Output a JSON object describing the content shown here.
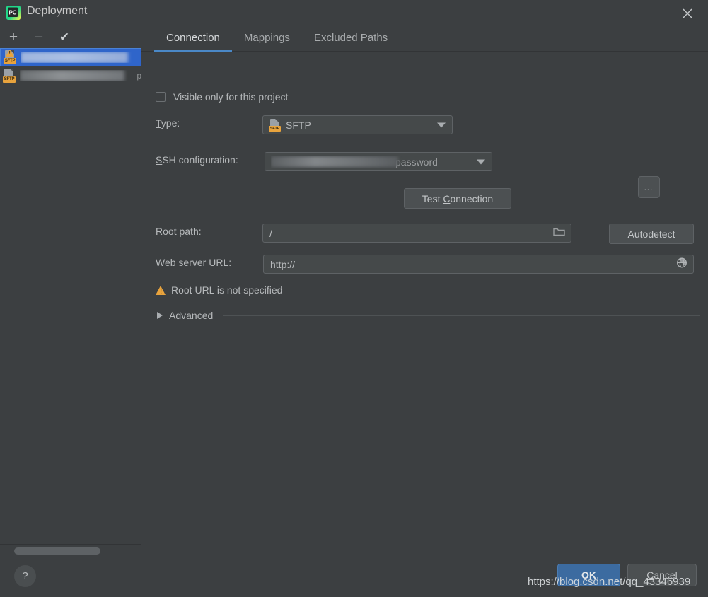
{
  "window": {
    "title": "Deployment",
    "app_icon": "pycharm-logo-icon",
    "close_icon": "close-icon"
  },
  "sidebar": {
    "toolbar": {
      "add_label": "+",
      "remove_label": "−",
      "set_default_label": "✔"
    },
    "servers": [
      {
        "label": "",
        "tail": "",
        "type": "SFTP",
        "selected": true,
        "has_warning": true,
        "redacted": true
      },
      {
        "label": "",
        "tail": "p",
        "type": "SFTP",
        "selected": false,
        "has_warning": false,
        "redacted": true
      }
    ]
  },
  "main": {
    "tabs": [
      {
        "label": "Connection",
        "active": true
      },
      {
        "label": "Mappings",
        "active": false
      },
      {
        "label": "Excluded Paths",
        "active": false
      }
    ],
    "visible_only": {
      "label": "Visible only for this project",
      "checked": false
    },
    "type": {
      "label": "Type:",
      "mnemonic": "T",
      "value": "SFTP",
      "icon": "sftp-icon"
    },
    "ssh_configuration": {
      "label": "SSH configuration:",
      "mnemonic": "S",
      "value_suffix": "password",
      "value_redacted": true,
      "browse_label": "..."
    },
    "test_connection": {
      "label": "Test Connection",
      "mnemonic": "C"
    },
    "root_path": {
      "label": "Root path:",
      "mnemonic": "R",
      "value": "/",
      "browse_icon": "folder-icon",
      "help_icon": "help-icon",
      "autodetect_label": "Autodetect"
    },
    "web_server_url": {
      "label": "Web server URL:",
      "mnemonic": "W",
      "value": "http://",
      "open_icon": "globe-icon"
    },
    "warning": {
      "icon": "warning-triangle-icon",
      "text": "Root URL is not specified"
    },
    "advanced": {
      "label": "Advanced",
      "expanded": false,
      "toggle_icon": "chevron-right-icon"
    }
  },
  "footer": {
    "help_label": "?",
    "ok_label": "OK",
    "cancel_label": "Cancel",
    "cancel_mnemonic": "C"
  },
  "overlay": {
    "watermark": "https://blog.csdn.net/qq_43346939"
  },
  "colors": {
    "background": "#3c3f41",
    "accent": "#4a88c7",
    "selection": "#2f65ca",
    "ok_button": "#3c6ba0",
    "warning": "#e8a33d",
    "text": "#b6b9bb"
  }
}
